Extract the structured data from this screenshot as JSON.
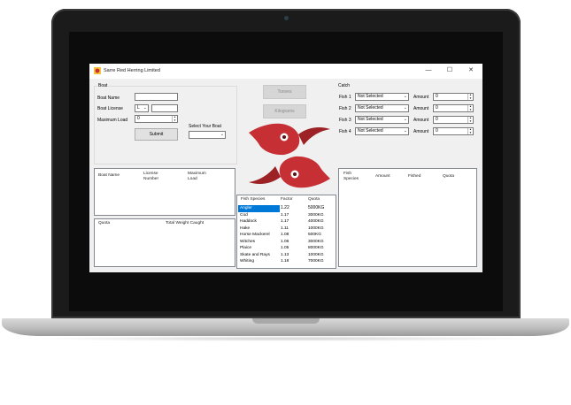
{
  "window": {
    "title": "Sarre Red Herring Limited",
    "icon": "app-fish-icon",
    "controls": {
      "minimize": "—",
      "maximize": "☐",
      "close": "✕"
    }
  },
  "boat": {
    "group_label": "Boat",
    "name_label": "Boat Name",
    "name_value": "",
    "license_label": "Boat License",
    "license_prefix": "L",
    "license_value": "",
    "max_load_label": "Maximum Load",
    "max_load_value": "0",
    "submit_label": "Submit",
    "select_label": "Select Your Boat",
    "select_value": ""
  },
  "buttons": {
    "tonnes": "Tonnes",
    "kilograms": "Kilograms"
  },
  "boat_list": {
    "columns": [
      "Boat Name",
      "License\nNumber",
      "Maximum\nLoad"
    ]
  },
  "quota_list": {
    "columns": [
      "Quota",
      "Total Weight Caught"
    ]
  },
  "catch": {
    "group_label": "Catch",
    "rows": [
      {
        "label": "Fish 1",
        "selection": "Not Selected",
        "amount_label": "Amount",
        "amount": "0"
      },
      {
        "label": "Fish 2",
        "selection": "Not Selected",
        "amount_label": "Amount",
        "amount": "0"
      },
      {
        "label": "Fish 3",
        "selection": "Not Selected",
        "amount_label": "Amount",
        "amount": "0"
      },
      {
        "label": "Fish 4",
        "selection": "Not Selected",
        "amount_label": "Amount",
        "amount": "0"
      }
    ]
  },
  "catch_list": {
    "columns": [
      "Fish\nSpecies",
      "Amount",
      "Fished",
      "Quota"
    ]
  },
  "species_table": {
    "columns": [
      "Fish Species",
      "Factor",
      "Quota"
    ],
    "rows": [
      {
        "species": "Angler",
        "factor": "1.22",
        "quota": "5000KG",
        "selected": true
      },
      {
        "species": "Cod",
        "factor": "1.17",
        "quota": "3000KG"
      },
      {
        "species": "Haddock",
        "factor": "1.17",
        "quota": "4000KG"
      },
      {
        "species": "Hake",
        "factor": "1.11",
        "quota": "1000KG"
      },
      {
        "species": "Horse Mackerel",
        "factor": "1.08",
        "quota": "500KG"
      },
      {
        "species": "Witches",
        "factor": "1.06",
        "quota": "3000KG"
      },
      {
        "species": "Plaice",
        "factor": "1.05",
        "quota": "8000KG"
      },
      {
        "species": "Skate and Rays",
        "factor": "1.13",
        "quota": "1000KG"
      },
      {
        "species": "Whiting",
        "factor": "1.18",
        "quota": "7000KG"
      }
    ]
  },
  "colors": {
    "logo_red": "#c62f33",
    "selection_blue": "#0078d7",
    "window_bg": "#f0f0f0"
  }
}
